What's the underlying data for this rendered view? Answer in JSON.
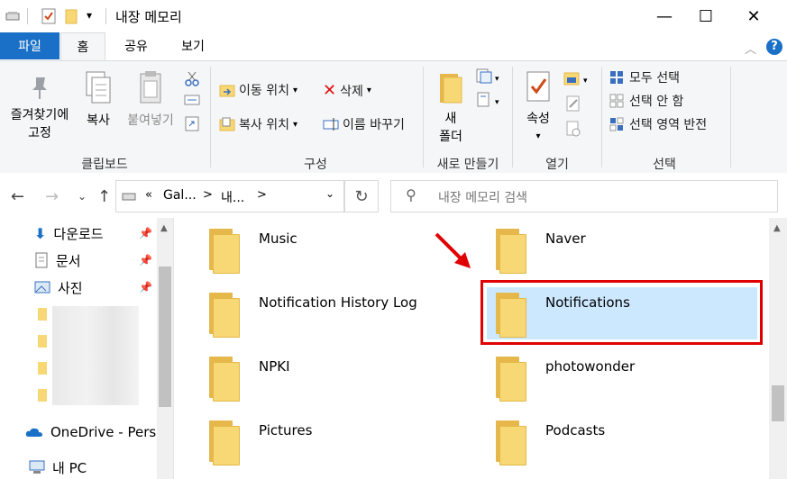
{
  "window": {
    "title": "내장 메모리",
    "minimize_glyph": "—",
    "maximize_glyph": "☐",
    "close_glyph": "✕"
  },
  "ribbon_tabs": [
    "파일",
    "홈",
    "공유",
    "보기"
  ],
  "ribbon": {
    "clipboard": {
      "pin_label_1": "즐겨찾기에",
      "pin_label_2": "고정",
      "copy_label": "복사",
      "paste_label": "붙여넣기",
      "group_label": "클립보드"
    },
    "organize": {
      "move_to_label": "이동 위치",
      "copy_to_label": "복사 위치",
      "delete_label": "삭제",
      "rename_label": "이름 바꾸기",
      "group_label": "구성"
    },
    "new": {
      "new_folder_label_1": "새",
      "new_folder_label_2": "폴더",
      "group_label": "새로 만들기"
    },
    "open": {
      "properties_label": "속성",
      "group_label": "열기"
    },
    "select": {
      "select_all_label": "모두 선택",
      "select_none_label": "선택 안 함",
      "invert_label": "선택 영역 반전",
      "group_label": "선택"
    }
  },
  "address": {
    "overflow": "«",
    "crumb_1": "Gal...",
    "crumb_2": "내...",
    "separator": ">",
    "search_placeholder": "내장 메모리 검색"
  },
  "nav_pane": {
    "quick_access": [
      "다운로드",
      "문서",
      "사진"
    ],
    "onedrive": "OneDrive - Person",
    "this_pc": "내 PC"
  },
  "content": {
    "folders_left": [
      "Music",
      "Notification History Log",
      "NPKI",
      "Pictures"
    ],
    "folders_right": [
      "Naver",
      "Notifications",
      "photowonder",
      "Podcasts"
    ],
    "selected": "Notifications"
  },
  "colors": {
    "file_tab": "#1a6fc6",
    "selection": "#cce8ff",
    "highlight_box": "#e00000",
    "folder_front": "#f8d775",
    "folder_back": "#e6b84c"
  }
}
